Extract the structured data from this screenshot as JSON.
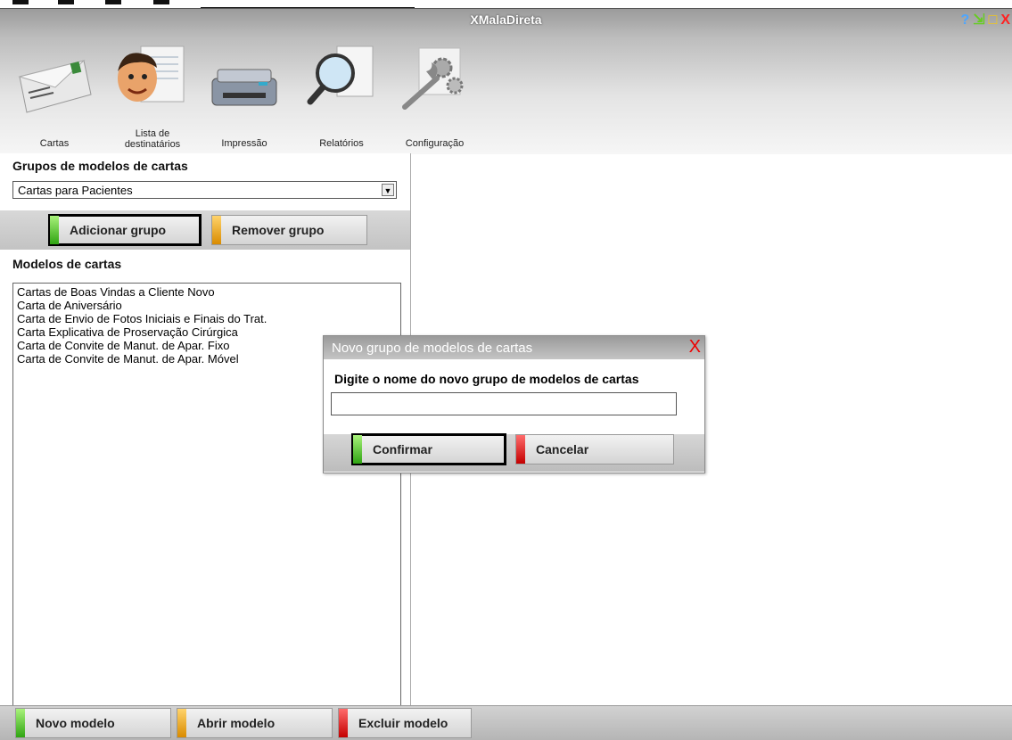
{
  "window": {
    "title": "XMalaDireta",
    "controls": {
      "help": "?",
      "minimize": "⇲",
      "maximize": "□",
      "close": "X"
    }
  },
  "toolbar": {
    "items": [
      {
        "label": "Cartas",
        "icon": "envelope-icon"
      },
      {
        "label": "Lista de destinatários",
        "icon": "person-list-icon"
      },
      {
        "label": "Impressão",
        "icon": "printer-icon"
      },
      {
        "label": "Relatórios",
        "icon": "magnifier-report-icon"
      },
      {
        "label": "Configuração",
        "icon": "wrench-gear-icon"
      }
    ]
  },
  "groups": {
    "title": "Grupos de modelos de cartas",
    "selected": "Cartas para Pacientes",
    "add_label": "Adicionar grupo",
    "remove_label": "Remover grupo"
  },
  "models": {
    "title": "Modelos de cartas",
    "items": [
      "Cartas de Boas Vindas a Cliente Novo",
      "Carta de Aniversário",
      "Carta de Envio de Fotos Iniciais e Finais do Trat.",
      "Carta Explicativa de Proservação Cirúrgica",
      "Carta de Convite de Manut. de Apar. Fixo",
      "Carta de Convite de Manut. de Apar. Móvel"
    ]
  },
  "bottom": {
    "new_label": "Novo modelo",
    "open_label": "Abrir modelo",
    "delete_label": "Excluir modelo"
  },
  "dialog": {
    "title": "Novo grupo de modelos de cartas",
    "close": "X",
    "prompt": "Digite o nome do novo grupo de modelos de cartas",
    "input_value": "",
    "confirm_label": "Confirmar",
    "cancel_label": "Cancelar"
  },
  "colors": {
    "accent_green": "#3cb521",
    "accent_orange": "#e59a00",
    "accent_red": "#d40000",
    "close_red": "#ee0000"
  }
}
